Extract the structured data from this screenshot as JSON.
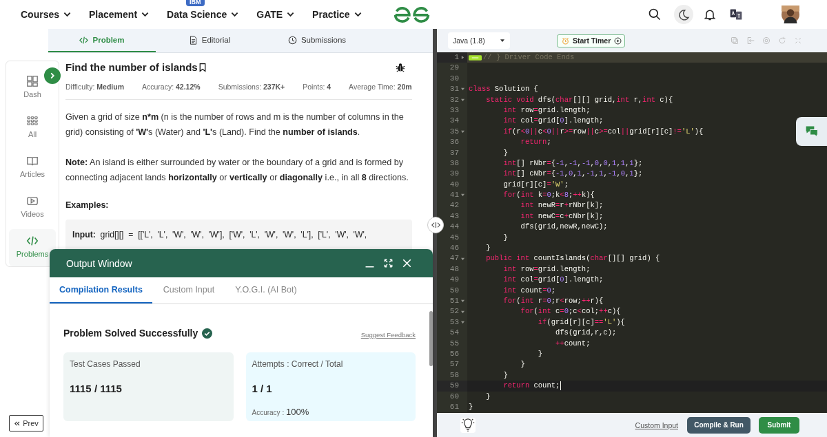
{
  "nav": {
    "items": [
      {
        "label": "Courses"
      },
      {
        "label": "Placement"
      },
      {
        "label": "Data Science",
        "badge": "IBM"
      },
      {
        "label": "GATE"
      },
      {
        "label": "Practice"
      }
    ]
  },
  "problem_tabs": [
    {
      "label": "Problem",
      "selected": true
    },
    {
      "label": "Editorial",
      "selected": false
    },
    {
      "label": "Submissions",
      "selected": false
    }
  ],
  "sidebar": {
    "items": [
      {
        "label": "Dash",
        "selected": false
      },
      {
        "label": "All",
        "selected": false
      },
      {
        "label": "Articles",
        "selected": false
      },
      {
        "label": "Videos",
        "selected": false
      },
      {
        "label": "Problems",
        "selected": true
      }
    ],
    "prev": "Prev"
  },
  "problem": {
    "title": "Find the number of islands",
    "meta": [
      {
        "label": "Difficulty:",
        "value": "Medium"
      },
      {
        "label": "Accuracy:",
        "value": "42.12%"
      },
      {
        "label": "Submissions:",
        "value": "237K+"
      },
      {
        "label": "Points:",
        "value": "4"
      },
      {
        "label": "Average Time:",
        "value": "20m"
      }
    ],
    "paragraphs": [
      [
        {
          "text": "Given a grid of size ",
          "bold": false
        },
        {
          "text": "n*m",
          "bold": true
        },
        {
          "text": " (n is the number of rows and m is the number of columns in the grid) consisting of ",
          "bold": false
        },
        {
          "text": "'W'",
          "bold": true
        },
        {
          "text": "s (Water) and ",
          "bold": false
        },
        {
          "text": "'L'",
          "bold": true
        },
        {
          "text": "s (Land). Find the ",
          "bold": false
        },
        {
          "text": "number of islands",
          "bold": true
        },
        {
          "text": ".",
          "bold": false
        }
      ],
      [
        {
          "text": "Note:",
          "bold": true
        },
        {
          "text": " An island is either surrounded by water or the boundary of a grid and is formed by connecting adjacent lands ",
          "bold": false
        },
        {
          "text": "horizontally",
          "bold": true
        },
        {
          "text": " or ",
          "bold": false
        },
        {
          "text": "vertically",
          "bold": true
        },
        {
          "text": " or ",
          "bold": false
        },
        {
          "text": "diagonally",
          "bold": true
        },
        {
          "text": " i.e., in all ",
          "bold": false
        },
        {
          "text": "8",
          "bold": true
        },
        {
          "text": " directions.",
          "bold": false
        }
      ]
    ],
    "examples_heading": "Examples:",
    "example": [
      {
        "text": "Input:",
        "bold": true
      },
      {
        "text": "  grid[][]  =  [['L',  'L',  'W',  'W',  'W'],  ['W',  'L',  'W',  'W',  'L'],  ['L',  'W',  'W',",
        "bold": false
      }
    ]
  },
  "output_window": {
    "title": "Output Window",
    "tabs": [
      {
        "label": "Compilation Results",
        "selected": true
      },
      {
        "label": "Custom Input",
        "selected": false
      },
      {
        "label": "Y.O.G.I. (AI Bot)",
        "selected": false
      }
    ],
    "status": "Problem Solved Successfully",
    "feedback": "Suggest Feedback",
    "cards": [
      {
        "label": "Test Cases Passed",
        "value": "1115 / 1115"
      },
      {
        "label": "Attempts : Correct / Total",
        "value": "1 / 1",
        "extra_label": "Accuracy :",
        "extra_value": "100%"
      }
    ]
  },
  "editor": {
    "language": "Java (1.8)",
    "timer": "Start Timer",
    "lines": [
      {
        "number": "1",
        "fold": true,
        "collapsed": true,
        "active": false,
        "tokens": [
          {
            "kind": "comment",
            "text": "// } Driver Code Ends"
          }
        ]
      },
      {
        "number": "29",
        "fold": false,
        "collapsed": false,
        "active": false
      },
      {
        "number": "30",
        "fold": false,
        "collapsed": false,
        "active": false
      },
      {
        "number": "31",
        "fold": true,
        "collapsed": false,
        "active": false,
        "tokens": [
          {
            "kind": "kw",
            "text": "class"
          },
          {
            "kind": "plain",
            "text": " Solution {"
          }
        ]
      },
      {
        "number": "32",
        "fold": true,
        "collapsed": false,
        "active": false,
        "tokens": [
          {
            "kind": "kw",
            "text": "    static"
          },
          {
            "kind": "kw",
            "text": " void"
          },
          {
            "kind": "plain",
            "text": " dfs("
          },
          {
            "kind": "kw",
            "text": "char"
          },
          {
            "kind": "plain",
            "text": "[][] grid,"
          },
          {
            "kind": "kw",
            "text": "int"
          },
          {
            "kind": "plain",
            "text": " r,"
          },
          {
            "kind": "kw",
            "text": "int"
          },
          {
            "kind": "plain",
            "text": " c){"
          }
        ]
      },
      {
        "number": "33",
        "fold": false,
        "collapsed": false,
        "active": false,
        "tokens": [
          {
            "kind": "kw",
            "text": "        int"
          },
          {
            "kind": "plain",
            "text": " row"
          },
          {
            "kind": "op",
            "text": "="
          },
          {
            "kind": "plain",
            "text": "grid.length;"
          }
        ]
      },
      {
        "number": "34",
        "fold": false,
        "collapsed": false,
        "active": false,
        "tokens": [
          {
            "kind": "kw",
            "text": "        int"
          },
          {
            "kind": "plain",
            "text": " col"
          },
          {
            "kind": "op",
            "text": "="
          },
          {
            "kind": "plain",
            "text": "grid["
          },
          {
            "kind": "num",
            "text": "0"
          },
          {
            "kind": "plain",
            "text": "].length;"
          }
        ]
      },
      {
        "number": "35",
        "fold": true,
        "collapsed": false,
        "active": false,
        "tokens": [
          {
            "kind": "kw",
            "text": "        if"
          },
          {
            "kind": "plain",
            "text": "(r"
          },
          {
            "kind": "op",
            "text": "<"
          },
          {
            "kind": "num",
            "text": "0"
          },
          {
            "kind": "op",
            "text": "||"
          },
          {
            "kind": "plain",
            "text": "c"
          },
          {
            "kind": "op",
            "text": "<"
          },
          {
            "kind": "num",
            "text": "0"
          },
          {
            "kind": "op",
            "text": "||"
          },
          {
            "kind": "plain",
            "text": "r"
          },
          {
            "kind": "op",
            "text": ">="
          },
          {
            "kind": "plain",
            "text": "row"
          },
          {
            "kind": "op",
            "text": "||"
          },
          {
            "kind": "plain",
            "text": "c"
          },
          {
            "kind": "op",
            "text": ">="
          },
          {
            "kind": "plain",
            "text": "col"
          },
          {
            "kind": "op",
            "text": "||"
          },
          {
            "kind": "plain",
            "text": "grid[r][c]"
          },
          {
            "kind": "op",
            "text": "!="
          },
          {
            "kind": "str",
            "text": "'L'"
          },
          {
            "kind": "plain",
            "text": "){"
          }
        ]
      },
      {
        "number": "36",
        "fold": false,
        "collapsed": false,
        "active": false,
        "tokens": [
          {
            "kind": "kw",
            "text": "            return"
          },
          {
            "kind": "plain",
            "text": ";"
          }
        ]
      },
      {
        "number": "37",
        "fold": false,
        "collapsed": false,
        "active": false,
        "tokens": [
          {
            "kind": "plain",
            "text": "        }"
          }
        ]
      },
      {
        "number": "38",
        "fold": false,
        "collapsed": false,
        "active": false,
        "tokens": [
          {
            "kind": "kw",
            "text": "        int"
          },
          {
            "kind": "plain",
            "text": "[] rNbr"
          },
          {
            "kind": "op",
            "text": "="
          },
          {
            "kind": "plain",
            "text": "{"
          },
          {
            "kind": "num",
            "text": "-1"
          },
          {
            "kind": "plain",
            "text": ","
          },
          {
            "kind": "num",
            "text": "-1"
          },
          {
            "kind": "plain",
            "text": ","
          },
          {
            "kind": "num",
            "text": "-1"
          },
          {
            "kind": "plain",
            "text": ","
          },
          {
            "kind": "num",
            "text": "0"
          },
          {
            "kind": "plain",
            "text": ","
          },
          {
            "kind": "num",
            "text": "0"
          },
          {
            "kind": "plain",
            "text": ","
          },
          {
            "kind": "num",
            "text": "1"
          },
          {
            "kind": "plain",
            "text": ","
          },
          {
            "kind": "num",
            "text": "1"
          },
          {
            "kind": "plain",
            "text": ","
          },
          {
            "kind": "num",
            "text": "1"
          },
          {
            "kind": "plain",
            "text": "};"
          }
        ]
      },
      {
        "number": "39",
        "fold": false,
        "collapsed": false,
        "active": false,
        "tokens": [
          {
            "kind": "kw",
            "text": "        int"
          },
          {
            "kind": "plain",
            "text": "[] cNbr"
          },
          {
            "kind": "op",
            "text": "="
          },
          {
            "kind": "plain",
            "text": "{"
          },
          {
            "kind": "num",
            "text": "-1"
          },
          {
            "kind": "plain",
            "text": ","
          },
          {
            "kind": "num",
            "text": "0"
          },
          {
            "kind": "plain",
            "text": ","
          },
          {
            "kind": "num",
            "text": "1"
          },
          {
            "kind": "plain",
            "text": ","
          },
          {
            "kind": "num",
            "text": "-1"
          },
          {
            "kind": "plain",
            "text": ","
          },
          {
            "kind": "num",
            "text": "1"
          },
          {
            "kind": "plain",
            "text": ","
          },
          {
            "kind": "num",
            "text": "-1"
          },
          {
            "kind": "plain",
            "text": ","
          },
          {
            "kind": "num",
            "text": "0"
          },
          {
            "kind": "plain",
            "text": ","
          },
          {
            "kind": "num",
            "text": "1"
          },
          {
            "kind": "plain",
            "text": "};"
          }
        ]
      },
      {
        "number": "40",
        "fold": false,
        "collapsed": false,
        "active": false,
        "tokens": [
          {
            "kind": "plain",
            "text": "        grid[r][c]"
          },
          {
            "kind": "op",
            "text": "="
          },
          {
            "kind": "str",
            "text": "'W'"
          },
          {
            "kind": "plain",
            "text": ";"
          }
        ]
      },
      {
        "number": "41",
        "fold": true,
        "collapsed": false,
        "active": false,
        "tokens": [
          {
            "kind": "kw",
            "text": "        for"
          },
          {
            "kind": "plain",
            "text": "("
          },
          {
            "kind": "kw",
            "text": "int"
          },
          {
            "kind": "plain",
            "text": " k"
          },
          {
            "kind": "op",
            "text": "="
          },
          {
            "kind": "num",
            "text": "0"
          },
          {
            "kind": "plain",
            "text": ";k"
          },
          {
            "kind": "op",
            "text": "<"
          },
          {
            "kind": "num",
            "text": "8"
          },
          {
            "kind": "plain",
            "text": ";"
          },
          {
            "kind": "op",
            "text": "++"
          },
          {
            "kind": "plain",
            "text": "k){"
          }
        ]
      },
      {
        "number": "42",
        "fold": false,
        "collapsed": false,
        "active": false,
        "tokens": [
          {
            "kind": "kw",
            "text": "            int"
          },
          {
            "kind": "plain",
            "text": " newR"
          },
          {
            "kind": "op",
            "text": "="
          },
          {
            "kind": "plain",
            "text": "r"
          },
          {
            "kind": "op",
            "text": "+"
          },
          {
            "kind": "plain",
            "text": "rNbr[k];"
          }
        ]
      },
      {
        "number": "43",
        "fold": false,
        "collapsed": false,
        "active": false,
        "tokens": [
          {
            "kind": "kw",
            "text": "            int"
          },
          {
            "kind": "plain",
            "text": " newC"
          },
          {
            "kind": "op",
            "text": "="
          },
          {
            "kind": "plain",
            "text": "c"
          },
          {
            "kind": "op",
            "text": "+"
          },
          {
            "kind": "plain",
            "text": "cNbr[k];"
          }
        ]
      },
      {
        "number": "44",
        "fold": false,
        "collapsed": false,
        "active": false,
        "tokens": [
          {
            "kind": "plain",
            "text": "            dfs(grid,newR,newC);"
          }
        ]
      },
      {
        "number": "45",
        "fold": false,
        "collapsed": false,
        "active": false,
        "tokens": [
          {
            "kind": "plain",
            "text": "        }"
          }
        ]
      },
      {
        "number": "46",
        "fold": false,
        "collapsed": false,
        "active": false,
        "tokens": [
          {
            "kind": "plain",
            "text": "    }"
          }
        ]
      },
      {
        "number": "47",
        "fold": true,
        "collapsed": false,
        "active": false,
        "tokens": [
          {
            "kind": "kw",
            "text": "    public"
          },
          {
            "kind": "kw",
            "text": " int"
          },
          {
            "kind": "plain",
            "text": " countIslands("
          },
          {
            "kind": "kw",
            "text": "char"
          },
          {
            "kind": "plain",
            "text": "[][] grid) {"
          }
        ]
      },
      {
        "number": "48",
        "fold": false,
        "collapsed": false,
        "active": false,
        "tokens": [
          {
            "kind": "kw",
            "text": "        int"
          },
          {
            "kind": "plain",
            "text": " row"
          },
          {
            "kind": "op",
            "text": "="
          },
          {
            "kind": "plain",
            "text": "grid.length;"
          }
        ]
      },
      {
        "number": "49",
        "fold": false,
        "collapsed": false,
        "active": false,
        "tokens": [
          {
            "kind": "kw",
            "text": "        int"
          },
          {
            "kind": "plain",
            "text": " col"
          },
          {
            "kind": "op",
            "text": "="
          },
          {
            "kind": "plain",
            "text": "grid["
          },
          {
            "kind": "num",
            "text": "0"
          },
          {
            "kind": "plain",
            "text": "].length;"
          }
        ]
      },
      {
        "number": "50",
        "fold": false,
        "collapsed": false,
        "active": false,
        "tokens": [
          {
            "kind": "kw",
            "text": "        int"
          },
          {
            "kind": "plain",
            "text": " count"
          },
          {
            "kind": "op",
            "text": "="
          },
          {
            "kind": "num",
            "text": "0"
          },
          {
            "kind": "plain",
            "text": ";"
          }
        ]
      },
      {
        "number": "51",
        "fold": true,
        "collapsed": false,
        "active": false,
        "tokens": [
          {
            "kind": "kw",
            "text": "        for"
          },
          {
            "kind": "plain",
            "text": "("
          },
          {
            "kind": "kw",
            "text": "int"
          },
          {
            "kind": "plain",
            "text": " r"
          },
          {
            "kind": "op",
            "text": "="
          },
          {
            "kind": "num",
            "text": "0"
          },
          {
            "kind": "plain",
            "text": ";r"
          },
          {
            "kind": "op",
            "text": "<"
          },
          {
            "kind": "plain",
            "text": "row;"
          },
          {
            "kind": "op",
            "text": "++"
          },
          {
            "kind": "plain",
            "text": "r){"
          }
        ]
      },
      {
        "number": "52",
        "fold": true,
        "collapsed": false,
        "active": false,
        "tokens": [
          {
            "kind": "kw",
            "text": "            for"
          },
          {
            "kind": "plain",
            "text": "("
          },
          {
            "kind": "kw",
            "text": "int"
          },
          {
            "kind": "plain",
            "text": " c"
          },
          {
            "kind": "op",
            "text": "="
          },
          {
            "kind": "num",
            "text": "0"
          },
          {
            "kind": "plain",
            "text": ";c"
          },
          {
            "kind": "op",
            "text": "<"
          },
          {
            "kind": "plain",
            "text": "col;"
          },
          {
            "kind": "op",
            "text": "++"
          },
          {
            "kind": "plain",
            "text": "c){"
          }
        ]
      },
      {
        "number": "53",
        "fold": true,
        "collapsed": false,
        "active": false,
        "tokens": [
          {
            "kind": "kw",
            "text": "                if"
          },
          {
            "kind": "plain",
            "text": "(grid[r][c]"
          },
          {
            "kind": "op",
            "text": "=="
          },
          {
            "kind": "str",
            "text": "'L'"
          },
          {
            "kind": "plain",
            "text": "){"
          }
        ]
      },
      {
        "number": "54",
        "fold": false,
        "collapsed": false,
        "active": false,
        "tokens": [
          {
            "kind": "plain",
            "text": "                    dfs(grid,r,c);"
          }
        ]
      },
      {
        "number": "55",
        "fold": false,
        "collapsed": false,
        "active": false,
        "tokens": [
          {
            "kind": "op",
            "text": "                    ++"
          },
          {
            "kind": "plain",
            "text": "count;"
          }
        ]
      },
      {
        "number": "56",
        "fold": false,
        "collapsed": false,
        "active": false,
        "tokens": [
          {
            "kind": "plain",
            "text": "                }"
          }
        ]
      },
      {
        "number": "57",
        "fold": false,
        "collapsed": false,
        "active": false,
        "tokens": [
          {
            "kind": "plain",
            "text": "            }"
          }
        ]
      },
      {
        "number": "58",
        "fold": false,
        "collapsed": false,
        "active": false,
        "tokens": [
          {
            "kind": "plain",
            "text": "        }"
          }
        ]
      },
      {
        "number": "59",
        "fold": false,
        "collapsed": false,
        "active": true,
        "tokens": [
          {
            "kind": "kw",
            "text": "        return"
          },
          {
            "kind": "plain",
            "text": " count;"
          }
        ]
      },
      {
        "number": "60",
        "fold": false,
        "collapsed": false,
        "active": false,
        "tokens": [
          {
            "kind": "plain",
            "text": "    }"
          }
        ]
      },
      {
        "number": "61",
        "fold": false,
        "collapsed": false,
        "active": false,
        "tokens": [
          {
            "kind": "plain",
            "text": "}"
          }
        ]
      }
    ],
    "custom_input": "Custom Input",
    "compile_run": "Compile & Run",
    "submit": "Submit"
  }
}
